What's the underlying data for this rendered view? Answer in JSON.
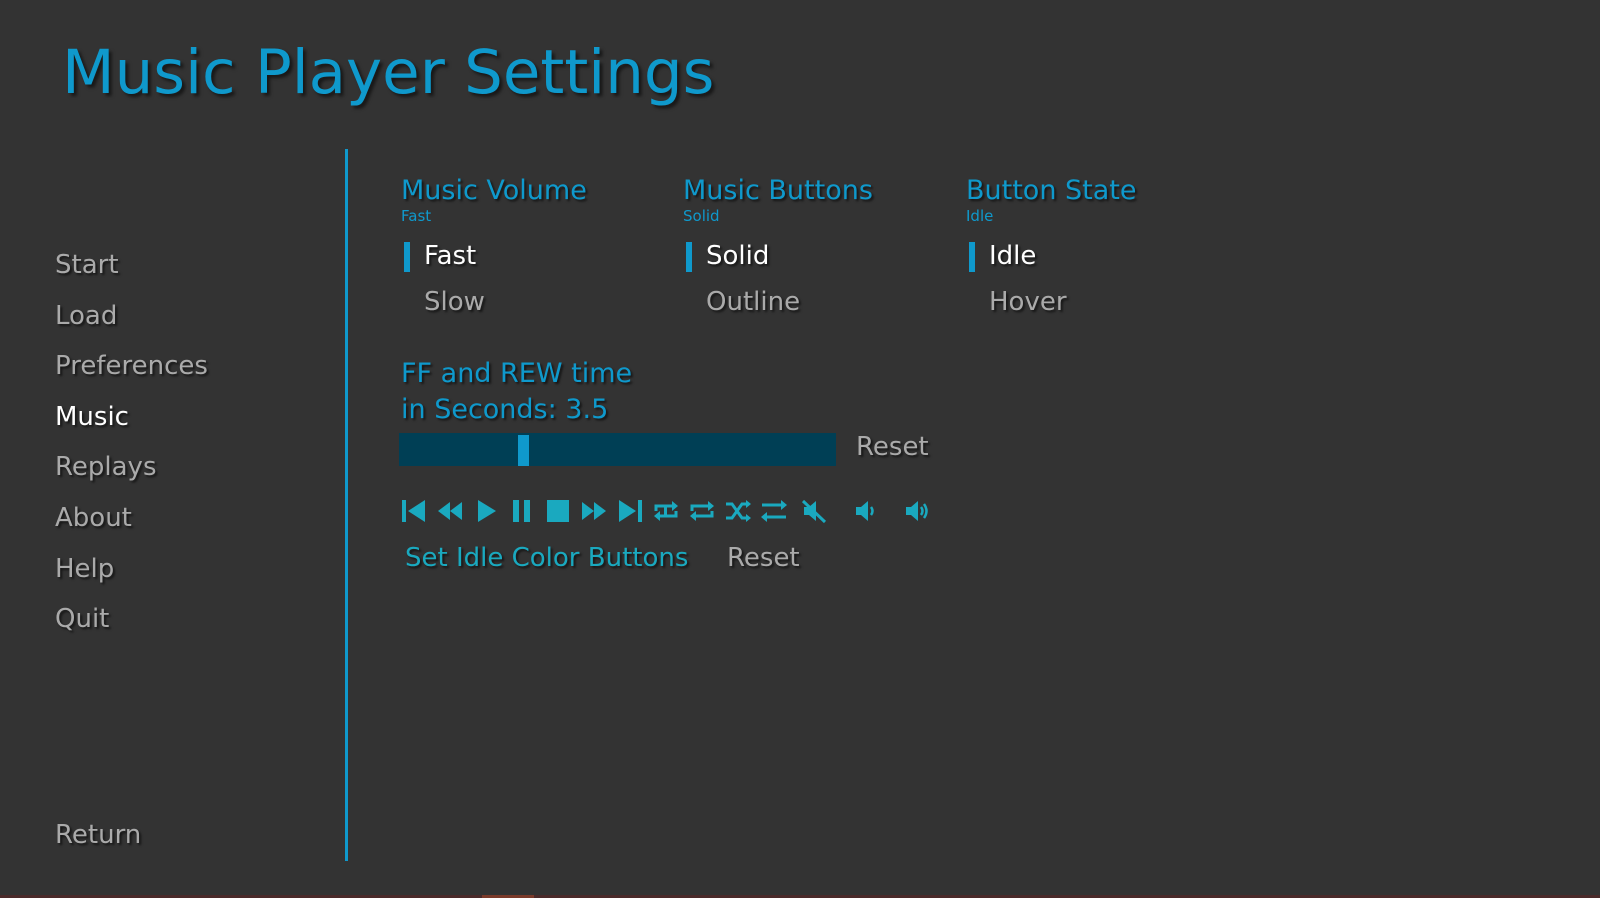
{
  "title": "Music Player Settings",
  "nav": {
    "items": [
      {
        "label": "Start",
        "selected": false
      },
      {
        "label": "Load",
        "selected": false
      },
      {
        "label": "Preferences",
        "selected": false
      },
      {
        "label": "Music",
        "selected": true
      },
      {
        "label": "Replays",
        "selected": false
      },
      {
        "label": "About",
        "selected": false
      },
      {
        "label": "Help",
        "selected": false
      },
      {
        "label": "Quit",
        "selected": false
      }
    ],
    "return_label": "Return"
  },
  "groups": [
    {
      "title": "Music Volume",
      "sub": "Fast",
      "options": [
        {
          "label": "Fast",
          "selected": true
        },
        {
          "label": "Slow",
          "selected": false
        }
      ]
    },
    {
      "title": "Music Buttons",
      "sub": "Solid",
      "options": [
        {
          "label": "Solid",
          "selected": true
        },
        {
          "label": "Outline",
          "selected": false
        }
      ]
    },
    {
      "title": "Button State",
      "sub": "Idle",
      "options": [
        {
          "label": "Idle",
          "selected": true
        },
        {
          "label": "Hover",
          "selected": false
        }
      ]
    }
  ],
  "ff_rew": {
    "label_line1": "FF and REW time",
    "label_line2": "in Seconds: 3.5",
    "value_fraction": 0.28,
    "reset_label": "Reset"
  },
  "music_buttons": [
    "skip-back-icon",
    "rewind-icon",
    "play-icon",
    "pause-icon",
    "stop-icon",
    "fast-forward-icon",
    "skip-forward-icon",
    "repeat-one-icon",
    "repeat-icon",
    "shuffle-icon",
    "repeat-off-icon",
    "mute-icon",
    "volume-down-icon",
    "volume-up-icon"
  ],
  "idle_colors": {
    "set_label": "Set Idle Color Buttons",
    "reset_label": "Reset"
  },
  "colors": {
    "accent": "#0f99cc",
    "background": "#333333",
    "button_teal": "#1aa9bf",
    "slider_track": "#003f55",
    "text_idle": "#aaaaaa",
    "text_selected": "#ffffff"
  }
}
